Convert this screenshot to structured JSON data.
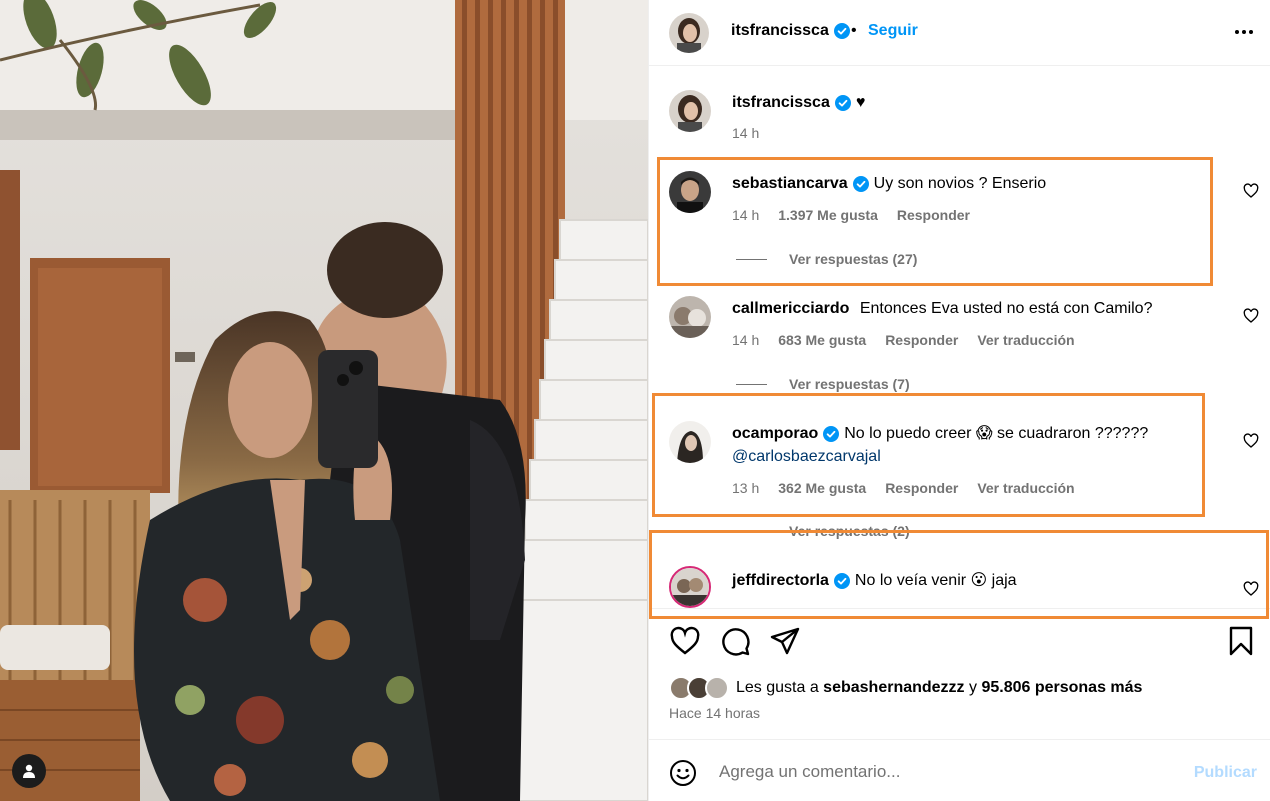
{
  "post": {
    "author": "itsfrancissca",
    "separator": "•",
    "follow_label": "Seguir",
    "caption": "♥",
    "caption_time": "14 h"
  },
  "comments": [
    {
      "user": "sebastiancarva",
      "verified": true,
      "text": "Uy son novios ? Enserio",
      "time": "14 h",
      "likes": "1.397 Me gusta",
      "reply": "Responder",
      "replies": "Ver respuestas (27)"
    },
    {
      "user": "callmericciardo",
      "verified": false,
      "text": "Entonces Eva usted no está con Camilo?",
      "time": "14 h",
      "likes": "683 Me gusta",
      "reply": "Responder",
      "translate": "Ver traducción",
      "replies": "Ver respuestas (7)"
    },
    {
      "user": "ocamporao",
      "verified": true,
      "text": "No lo puedo creer 😱 se cuadraron ??????",
      "mention": "@carlosbaezcarvajal",
      "time": "13 h",
      "likes": "362 Me gusta",
      "reply": "Responder",
      "translate": "Ver traducción",
      "replies": "Ver respuestas (2)"
    },
    {
      "user": "jeffdirectorla",
      "verified": true,
      "text": "No lo veía venir 😮 jaja"
    }
  ],
  "likes": {
    "prefix": "Les gusta a ",
    "user": "sebashernandezzz",
    "middle": " y ",
    "count": "95.806 personas más",
    "time": "Hace 14 horas"
  },
  "composer": {
    "placeholder": "Agrega un comentario...",
    "publish_label": "Publicar"
  },
  "colors": {
    "accent": "#0095f6",
    "highlight": "#f08a35",
    "muted": "#737373",
    "publish_disabled": "#b3dbff"
  },
  "icons": [
    "verified-icon",
    "more-options-icon",
    "heart-icon",
    "comment-icon",
    "share-icon",
    "save-icon",
    "emoji-icon",
    "user-tag-icon"
  ]
}
